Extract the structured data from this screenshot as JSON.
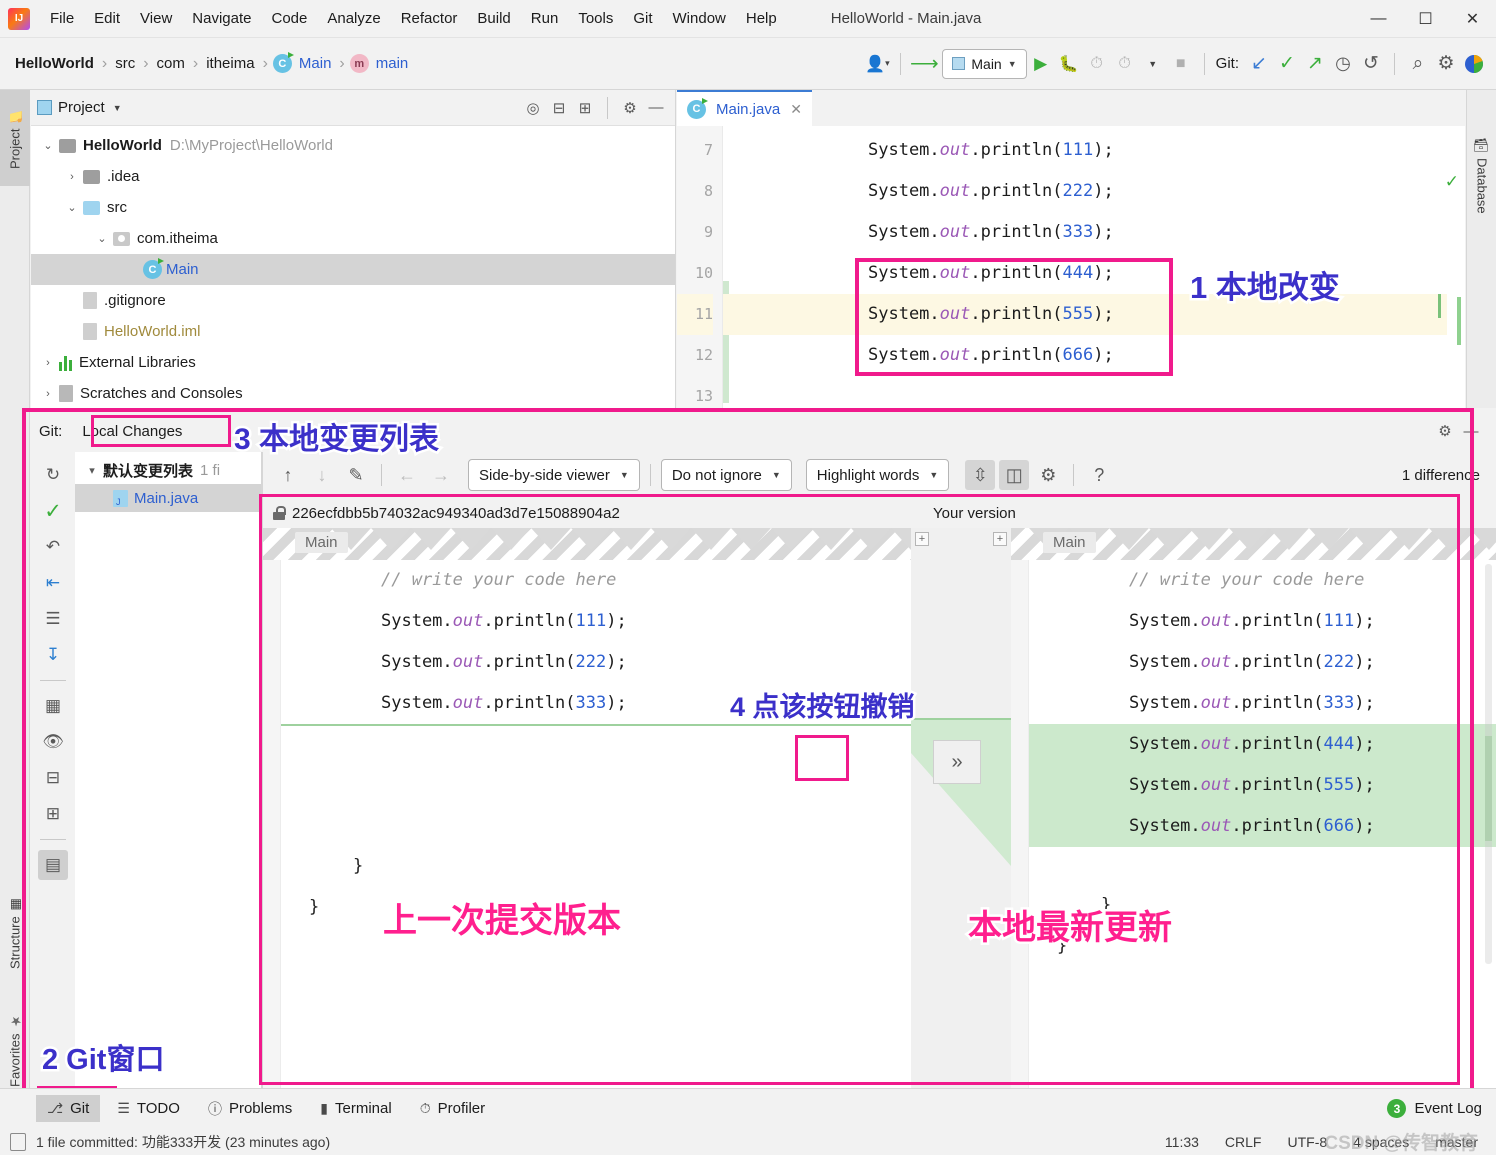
{
  "window": {
    "title": "HelloWorld - Main.java",
    "minimize": "—",
    "maximize": "☐",
    "close": "✕"
  },
  "menu": {
    "items": [
      "File",
      "Edit",
      "View",
      "Navigate",
      "Code",
      "Analyze",
      "Refactor",
      "Build",
      "Run",
      "Tools",
      "Git",
      "Window",
      "Help"
    ]
  },
  "navbar": {
    "crumbs": [
      "HelloWorld",
      "src",
      "com",
      "itheima",
      "Main",
      "main"
    ],
    "separator": "›",
    "run_config": "Main",
    "git_label": "Git:",
    "icons": {
      "user": "user-icon",
      "build": "build-icon",
      "run": "▶",
      "debug": "debug-icon",
      "coverage": "coverage-icon",
      "profile": "profile-icon",
      "stop": "■",
      "update": "↙",
      "commit": "✓",
      "push": "↗",
      "history": "◷",
      "rollback": "↺",
      "search": "⌕",
      "settings": "⚙"
    }
  },
  "left_stripe": {
    "project": "Project",
    "structure": "Structure",
    "favorites": "Favorites"
  },
  "right_stripe": {
    "database": "Database"
  },
  "project_panel": {
    "title": "Project",
    "tree": [
      {
        "label": "HelloWorld",
        "path": "D:\\MyProject\\HelloWorld",
        "arrow": "⌄",
        "indent": 0,
        "icon": "folder-module",
        "bold": true
      },
      {
        "label": ".idea",
        "path": "",
        "arrow": "›",
        "indent": 1,
        "icon": "folder-gray",
        "bold": false
      },
      {
        "label": "src",
        "path": "",
        "arrow": "⌄",
        "indent": 1,
        "icon": "folder-blue",
        "bold": false
      },
      {
        "label": "com.itheima",
        "path": "",
        "arrow": "⌄",
        "indent": 2,
        "icon": "folder-package",
        "bold": false
      },
      {
        "label": "Main",
        "path": "",
        "arrow": "",
        "indent": 3,
        "icon": "class-icon",
        "bold": false,
        "selected": true
      },
      {
        "label": ".gitignore",
        "path": "",
        "arrow": "",
        "indent": 1,
        "icon": "file-ignore",
        "bold": false
      },
      {
        "label": "HelloWorld.iml",
        "path": "",
        "arrow": "",
        "indent": 1,
        "icon": "file-iml",
        "bold": false
      },
      {
        "label": "External Libraries",
        "path": "",
        "arrow": "›",
        "indent": 0,
        "icon": "libraries-icon",
        "bold": false
      },
      {
        "label": "Scratches and Consoles",
        "path": "",
        "arrow": "›",
        "indent": 0,
        "icon": "scratches-icon",
        "bold": false
      }
    ]
  },
  "editor": {
    "tab": "Main.java",
    "tab_close": "✕",
    "lines": [
      {
        "no": "7",
        "code": "System.out.println(111);",
        "arg": "111",
        "highlight": false
      },
      {
        "no": "8",
        "code": "System.out.println(222);",
        "arg": "222",
        "highlight": false
      },
      {
        "no": "9",
        "code": "System.out.println(333);",
        "arg": "333",
        "highlight": false
      },
      {
        "no": "10",
        "code": "System.out.println(444);",
        "arg": "444",
        "highlight": false
      },
      {
        "no": "11",
        "code": "System.out.println(555);",
        "arg": "555",
        "highlight": true
      },
      {
        "no": "12",
        "code": "System.out.println(666);",
        "arg": "666",
        "highlight": false
      },
      {
        "no": "13",
        "code": "",
        "arg": "",
        "highlight": false
      }
    ]
  },
  "git_window": {
    "label": "Git:",
    "tab": "Local Changes",
    "changelist": {
      "name": "默认变更列表",
      "count": "1 fi",
      "files": [
        "Main.java"
      ]
    },
    "toolbar_icons": [
      "refresh-icon",
      "commit-check-icon",
      "rollback-icon",
      "shelve-icon",
      "comment-icon",
      "download-icon",
      "group-by-icon",
      "preview-eye-icon",
      "expand-all-icon",
      "collapse-all-icon",
      "layout-icon"
    ]
  },
  "diff": {
    "nav": {
      "prev": "↑",
      "next": "↓",
      "edit": "edit-icon",
      "left": "←",
      "right": "→"
    },
    "viewer_mode": "Side-by-side viewer",
    "ignore_mode": "Do not ignore",
    "highlight_mode": "Highlight words",
    "collapse_icon": "collapse-unchanged-icon",
    "whitespace_icon": "whitespace-icon",
    "settings_icon": "⚙",
    "help_icon": "?",
    "difference_count": "1 difference",
    "left_title": "226ecfdbb5b74032ac949340ad3d7e15088904a2",
    "right_title": "Your version",
    "fold_label": "Main",
    "accept_button": "»",
    "left_lines": [
      {
        "text": "// write your code here",
        "type": "comment"
      },
      {
        "text": "System.out.println(111);",
        "arg": "111",
        "type": "code"
      },
      {
        "text": "System.out.println(222);",
        "arg": "222",
        "type": "code"
      },
      {
        "text": "System.out.println(333);",
        "arg": "333",
        "type": "code"
      },
      {
        "text": "",
        "type": "gap"
      },
      {
        "text": "",
        "type": "gap"
      },
      {
        "text": "",
        "type": "gap"
      },
      {
        "text": "    }",
        "type": "plain"
      },
      {
        "text": "}",
        "type": "plain"
      }
    ],
    "right_lines": [
      {
        "text": "// write your code here",
        "type": "comment"
      },
      {
        "text": "System.out.println(111);",
        "arg": "111",
        "type": "code"
      },
      {
        "text": "System.out.println(222);",
        "arg": "222",
        "type": "code"
      },
      {
        "text": "System.out.println(333);",
        "arg": "333",
        "type": "code"
      },
      {
        "text": "System.out.println(444);",
        "arg": "444",
        "type": "added"
      },
      {
        "text": "System.out.println(555);",
        "arg": "555",
        "type": "added"
      },
      {
        "text": "System.out.println(666);",
        "arg": "666",
        "type": "added"
      },
      {
        "text": "    }",
        "type": "plain"
      },
      {
        "text": "}",
        "type": "plain"
      }
    ]
  },
  "annotations": [
    {
      "id": "a1",
      "text": "1 本地改变",
      "color": "blue"
    },
    {
      "id": "a2",
      "text": "2 Git窗口",
      "color": "blue"
    },
    {
      "id": "a3",
      "text": "3 本地变更列表",
      "color": "blue"
    },
    {
      "id": "a4",
      "text": "4 点该按钮撤销",
      "color": "blue"
    },
    {
      "id": "a5",
      "text": "上一次提交版本",
      "color": "pink"
    },
    {
      "id": "a6",
      "text": "本地最新更新",
      "color": "pink"
    }
  ],
  "bottom_toolbar": {
    "items": [
      {
        "label": "Git",
        "icon": "git-branch-icon",
        "selected": true
      },
      {
        "label": "TODO",
        "icon": "todo-list-icon",
        "selected": false
      },
      {
        "label": "Problems",
        "icon": "problems-icon",
        "selected": false
      },
      {
        "label": "Terminal",
        "icon": "terminal-icon",
        "selected": false
      },
      {
        "label": "Profiler",
        "icon": "profiler-icon",
        "selected": false
      }
    ],
    "event_log": "Event Log",
    "event_log_badge": "3"
  },
  "status_bar": {
    "message": "1 file committed: 功能333开发 (23 minutes ago)",
    "time": "11:33",
    "line_sep": "CRLF",
    "encoding": "UTF-8",
    "indent": "4 spaces",
    "branch": "master",
    "watermark": "CSDN @传智教育"
  },
  "colors": {
    "accent_pink": "#f01a8c",
    "annotation_blue": "#3b30c9",
    "annotation_pink": "#ff1f8e",
    "added_green": "#cce9cc",
    "link_blue": "#2d5fd0"
  }
}
